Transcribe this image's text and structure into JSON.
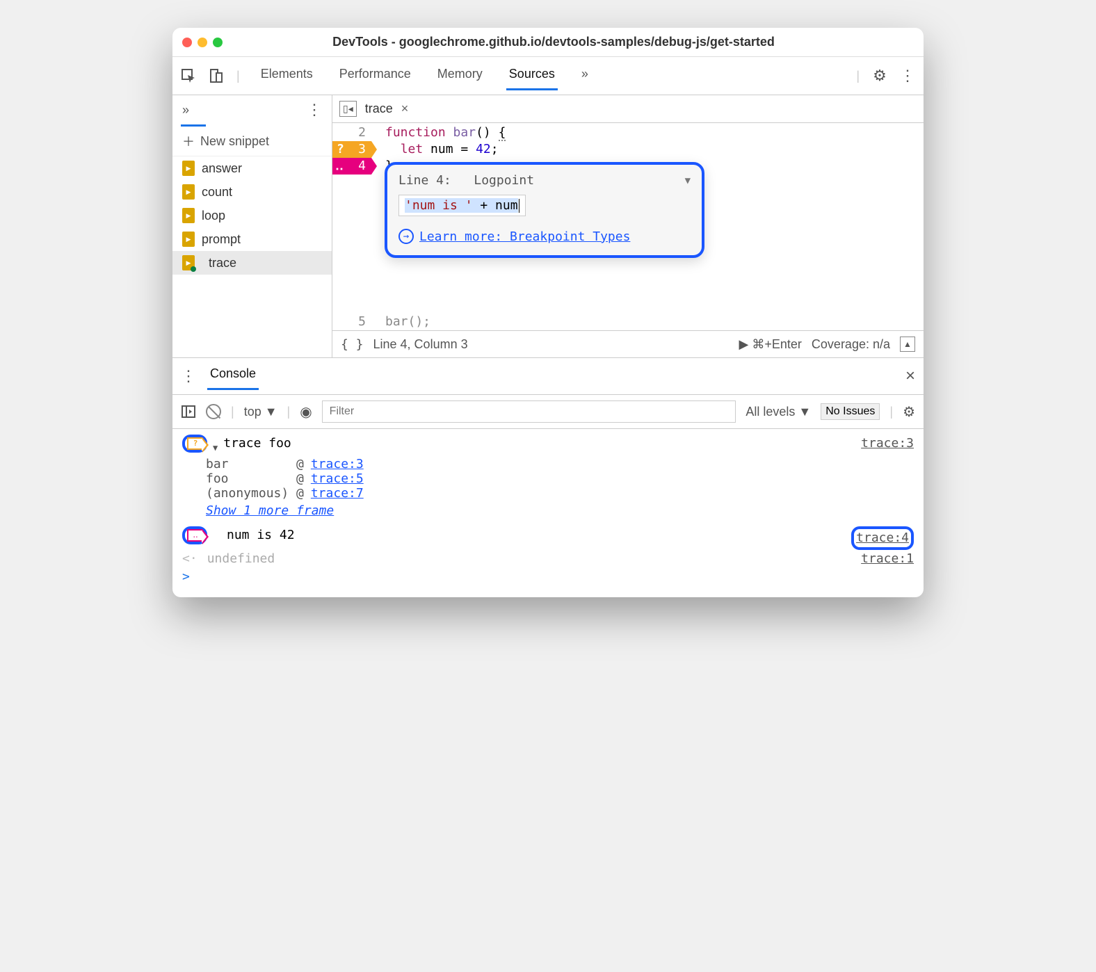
{
  "window": {
    "title": "DevTools - googlechrome.github.io/devtools-samples/debug-js/get-started"
  },
  "toolbar": {
    "tabs": [
      "Elements",
      "Performance",
      "Memory",
      "Sources"
    ],
    "active_tab": "Sources",
    "more_glyph": "»"
  },
  "sidebar": {
    "chevrons": "»",
    "new_snippet": "New snippet",
    "snippets": [
      {
        "name": "answer",
        "selected": false,
        "modified": false
      },
      {
        "name": "count",
        "selected": false,
        "modified": false
      },
      {
        "name": "loop",
        "selected": false,
        "modified": false
      },
      {
        "name": "prompt",
        "selected": false,
        "modified": false
      },
      {
        "name": "trace",
        "selected": true,
        "modified": true
      }
    ]
  },
  "editor": {
    "filename": "trace",
    "lines": {
      "2": {
        "text_html": "<span class='kw'>function</span> <span class='fn'>bar</span>() <span class='brace-u'>{</span>"
      },
      "3": {
        "text_html": "  <span class='kw'>let</span> num = <span class='num'>42</span>;"
      },
      "4": {
        "text_html": "}"
      },
      "5": {
        "text_html": "bar();"
      }
    },
    "status": {
      "format": "{ }",
      "pos": "Line 4, Column 3",
      "run": "▶ ⌘+Enter",
      "coverage": "Coverage: n/a"
    }
  },
  "popup": {
    "line_label": "Line 4:",
    "type": "Logpoint",
    "expr_html": "<span class='sel'><span class='str'>'num is '</span> + num</span>",
    "learn_more": "Learn more: Breakpoint Types"
  },
  "drawer": {
    "tab": "Console"
  },
  "console_filter": {
    "context": "top ▼",
    "placeholder": "Filter",
    "levels": "All levels ▼",
    "issues": "No Issues"
  },
  "console": {
    "trace_msg": "trace foo",
    "trace_src": "trace:3",
    "stack": [
      {
        "fn": "bar",
        "at": "trace:3"
      },
      {
        "fn": "foo",
        "at": "trace:5"
      },
      {
        "fn": "(anonymous)",
        "at": "trace:7"
      }
    ],
    "show_more": "Show 1 more frame",
    "logpoint_msg": "num is 42",
    "logpoint_src": "trace:4",
    "undefined_msg": "undefined",
    "undefined_src": "trace:1"
  }
}
